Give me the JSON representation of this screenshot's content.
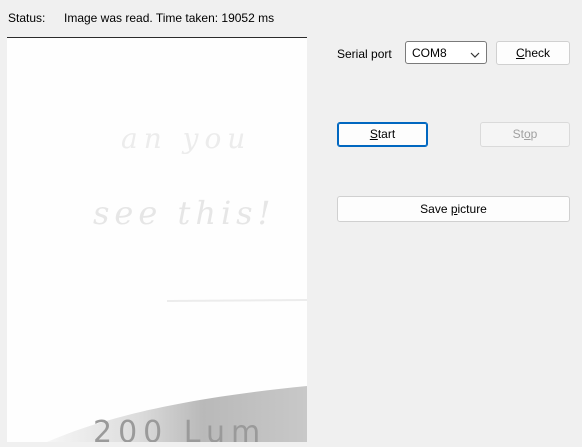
{
  "status": {
    "label": "Status:",
    "text": "Image was read. Time taken: 19052 ms"
  },
  "serial_port": {
    "label": "Serial port",
    "selected": "COM8",
    "check_label": {
      "pre": "",
      "key": "C",
      "post": "heck"
    }
  },
  "controls": {
    "start_label": {
      "pre": "",
      "key": "S",
      "post": "tart"
    },
    "stop_label": {
      "pre": "St",
      "key": "o",
      "post": "p"
    },
    "stop_enabled": false,
    "save_label": {
      "pre": "Save ",
      "key": "p",
      "post": "icture"
    }
  },
  "picture": {
    "handwriting_lines": [
      "an you",
      "see this!"
    ],
    "bottom_text": "200 Lum"
  },
  "colors": {
    "window_bg": "#f0f0f0",
    "accent": "#0067c0",
    "disabled_text": "#a0a0a0"
  },
  "icons": {
    "dropdown": "chevron-down-icon"
  }
}
